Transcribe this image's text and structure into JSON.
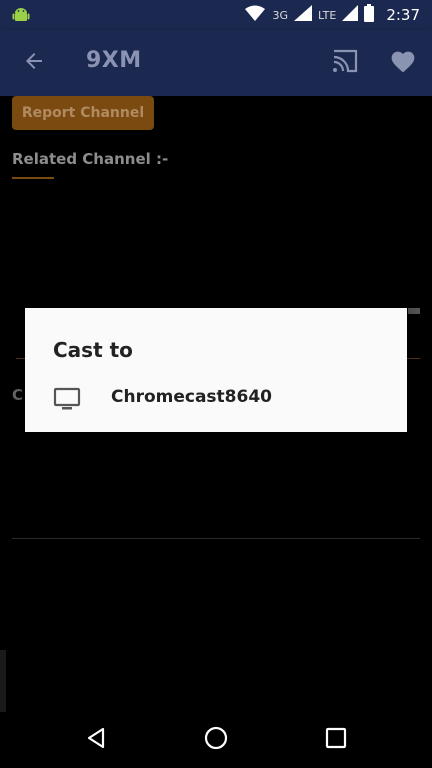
{
  "status_bar": {
    "network_3g": "3G",
    "network_lte": "LTE",
    "time": "2:37",
    "icons": [
      "android-icon",
      "wifi-icon",
      "signal-icon",
      "battery-icon"
    ]
  },
  "app_bar": {
    "title": "9XM",
    "icons": [
      "back-arrow-icon",
      "cast-icon",
      "heart-icon"
    ]
  },
  "content": {
    "report_button_label": "Report Channel",
    "related_title": "Related Channel :-",
    "faded_letter": "C"
  },
  "cast_dialog": {
    "title": "Cast to",
    "devices": [
      {
        "name": "Chromecast8640",
        "icon": "tv-icon"
      }
    ]
  },
  "colors": {
    "app_bar_bg": "#1b2850",
    "accent_orange": "#7a4a10",
    "dialog_bg": "#fafafa"
  }
}
